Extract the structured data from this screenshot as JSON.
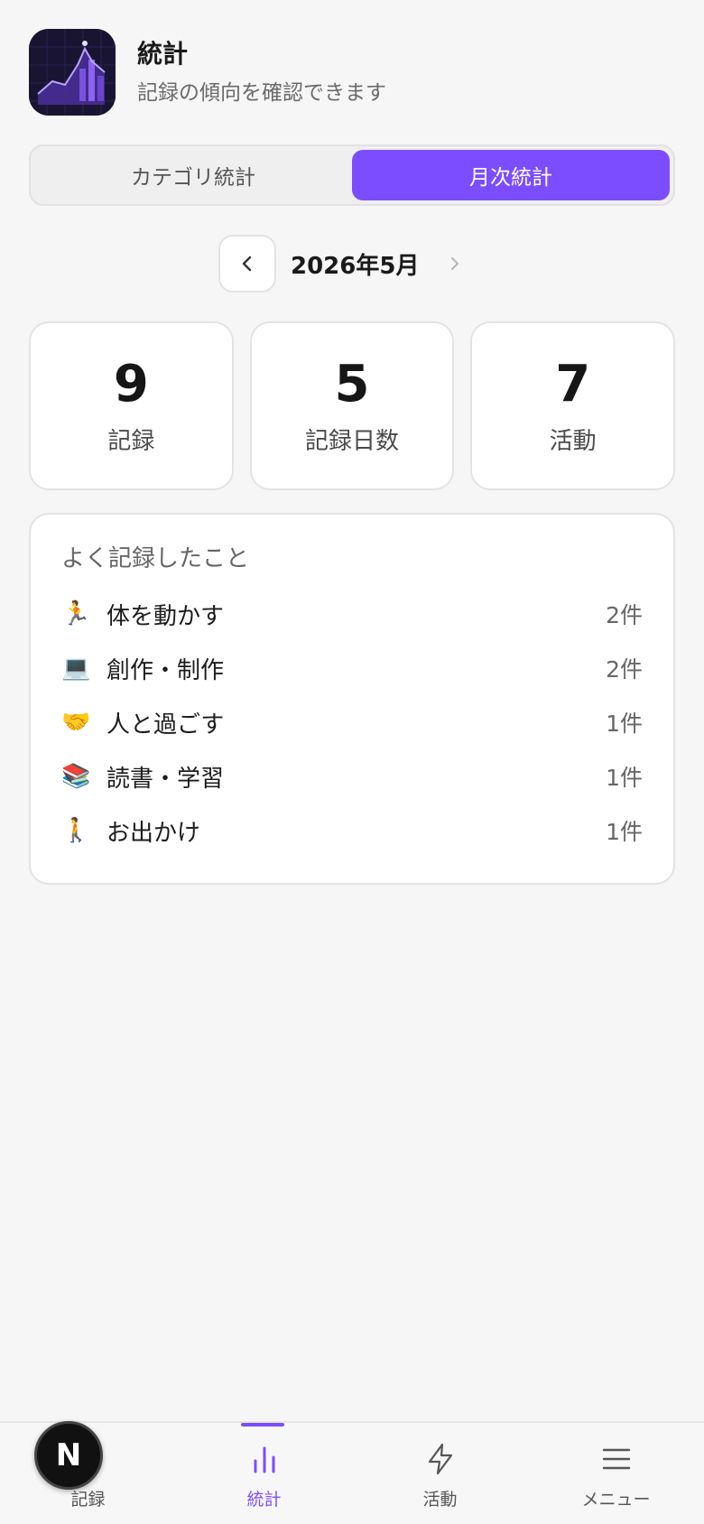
{
  "header": {
    "title": "統計",
    "subtitle": "記録の傾向を確認できます",
    "icon": "stats-app-icon"
  },
  "segment": {
    "tabs": [
      {
        "label": "カテゴリ統計",
        "active": false
      },
      {
        "label": "月次統計",
        "active": true
      }
    ]
  },
  "month": {
    "label": "2026年5月"
  },
  "stats": [
    {
      "value": "9",
      "label": "記録"
    },
    {
      "value": "5",
      "label": "記録日数"
    },
    {
      "value": "7",
      "label": "活動"
    }
  ],
  "top": {
    "title": "よく記録したこと",
    "items": [
      {
        "emoji": "🏃",
        "name": "体を動かす",
        "count": "2件"
      },
      {
        "emoji": "💻",
        "name": "創作・制作",
        "count": "2件"
      },
      {
        "emoji": "🤝",
        "name": "人と過ごす",
        "count": "1件"
      },
      {
        "emoji": "📚",
        "name": "読書・学習",
        "count": "1件"
      },
      {
        "emoji": "🚶",
        "name": "お出かけ",
        "count": "1件"
      }
    ]
  },
  "nav": {
    "items": [
      {
        "label": "記録",
        "icon": "clock-icon"
      },
      {
        "label": "統計",
        "icon": "bar-chart-icon"
      },
      {
        "label": "活動",
        "icon": "lightning-icon"
      },
      {
        "label": "メニュー",
        "icon": "menu-icon"
      }
    ]
  },
  "badge": {
    "text": "N"
  },
  "colors": {
    "accent": "#7b4dff",
    "background": "#f6f6f6"
  }
}
